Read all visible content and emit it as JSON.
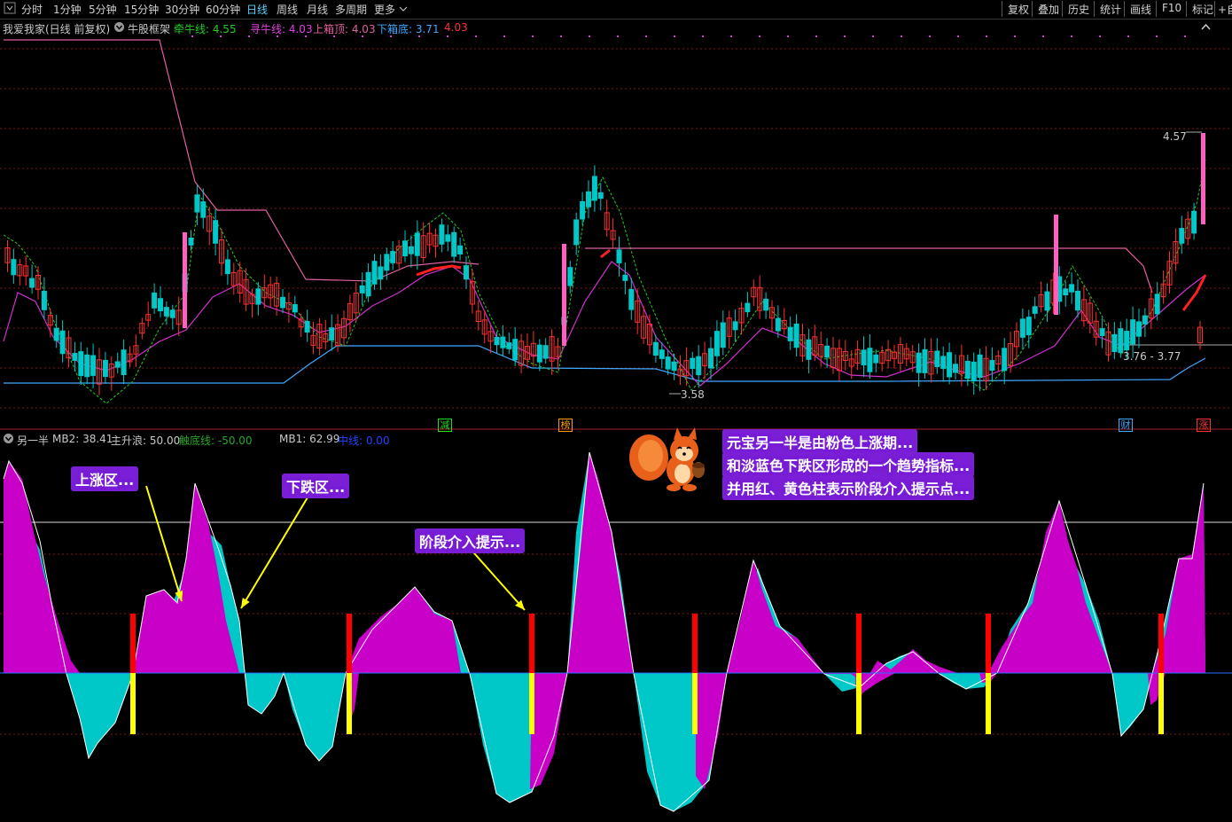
{
  "toolbar": {
    "tabs": [
      "分时",
      "1分钟",
      "5分钟",
      "15分钟",
      "30分钟",
      "60分钟",
      "日线",
      "周线",
      "月线",
      "多周期",
      "更多"
    ],
    "active_tab": "日线",
    "right_buttons": [
      "复权",
      "叠加",
      "历史",
      "统计",
      "画线",
      "F10",
      "标记",
      "+自"
    ]
  },
  "main_panel": {
    "stock_name": "我爱我家(日线 前复权)",
    "indicator_name": "牛股框架",
    "items": [
      {
        "label": "牵牛线: 4.55",
        "color": "#22cc22"
      },
      {
        "label": "寻牛线: 4.03",
        "color": "#e040e0"
      },
      {
        "label": "上箱顶: 4.03",
        "color": "#e060a0"
      },
      {
        "label": "下箱底: 3.71",
        "color": "#3fa8ff"
      },
      {
        "label": "4.03",
        "color": "#ff3030"
      }
    ],
    "price_high": "4.57",
    "price_low": "3.58",
    "price_range": "3.76 - 3.77"
  },
  "signals": [
    {
      "text": "减",
      "color": "#22dd22"
    },
    {
      "text": "榜",
      "color": "#ff9900"
    },
    {
      "text": "财",
      "color": "#3fa8ff"
    },
    {
      "text": "涨",
      "color": "#ff3030"
    }
  ],
  "sub_panel": {
    "indicator_name": "另一半",
    "items": [
      {
        "label": "MB2: 38.41",
        "color": "#c8c8c8"
      },
      {
        "label": "主升浪: 50.00",
        "color": "#c8c8c8"
      },
      {
        "label": "触底线: -50.00",
        "color": "#22aa22"
      },
      {
        "label": "MB1: 62.99",
        "color": "#c8c8c8"
      },
      {
        "label": "中线: 0.00",
        "color": "#2244ff"
      }
    ]
  },
  "annotations": {
    "up_zone": "上涨区...",
    "down_zone": "下跌区...",
    "entry_hint": "阶段介入提示...",
    "desc_line1": "元宝另一半是由粉色上涨期...",
    "desc_line2": "和淡蓝色下跌区形成的一个趋势指标...",
    "desc_line3": "并用红、黄色柱表示阶段介入提示点..."
  },
  "colors": {
    "up_fill": "#c800c8",
    "down_fill": "#00c8c8",
    "entry_red": "#ff0000",
    "entry_yellow": "#ffff00",
    "candle_up": "#ff3030",
    "candle_down": "#00c8c8",
    "pink_bar": "#ff60c0",
    "ann_bg": "#7a1fd6"
  }
}
